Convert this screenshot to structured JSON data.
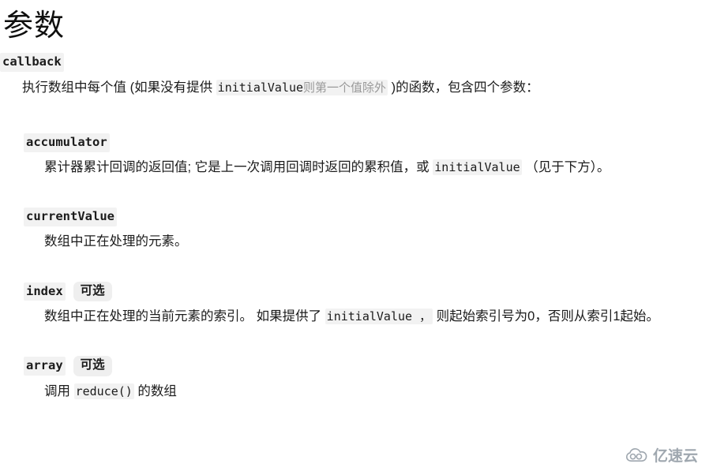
{
  "heading": "参数",
  "params": [
    {
      "name": "callback",
      "optional_badge": "",
      "desc_pre": "执行数组中每个值 (如果没有提供 ",
      "desc_code": "initialValue",
      "desc_code_muted": "则第一个值除外",
      "desc_post": " )的函数，包含四个参数："
    }
  ],
  "sub_params": [
    {
      "name": "accumulator",
      "optional_badge": "",
      "desc_pre": "累计器累计回调的返回值; 它是上一次调用回调时返回的累积值，或 ",
      "desc_code": "initialValue",
      "desc_post": " （见于下方）。"
    },
    {
      "name": "currentValue",
      "optional_badge": "",
      "desc_pre": "数组中正在处理的元素。",
      "desc_code": "",
      "desc_post": ""
    },
    {
      "name": "index",
      "optional_badge": "可选",
      "desc_pre": "数组中正在处理的当前元素的索引。 如果提供了 ",
      "desc_code": "initialValue ，",
      "desc_post": " 则起始索引号为0，否则从索引1起始。"
    },
    {
      "name": "array",
      "optional_badge": "可选",
      "desc_pre": "调用 ",
      "desc_code": "reduce()",
      "desc_post": " 的数组"
    }
  ],
  "watermark": {
    "text": "亿速云",
    "icon": "cloud-logo-icon",
    "color": "#9aa3ab"
  },
  "colors": {
    "code_background": "#f2f2f2",
    "badge_background": "#efefef",
    "text": "#1b1b1b",
    "muted_text": "#9a9a9a"
  }
}
